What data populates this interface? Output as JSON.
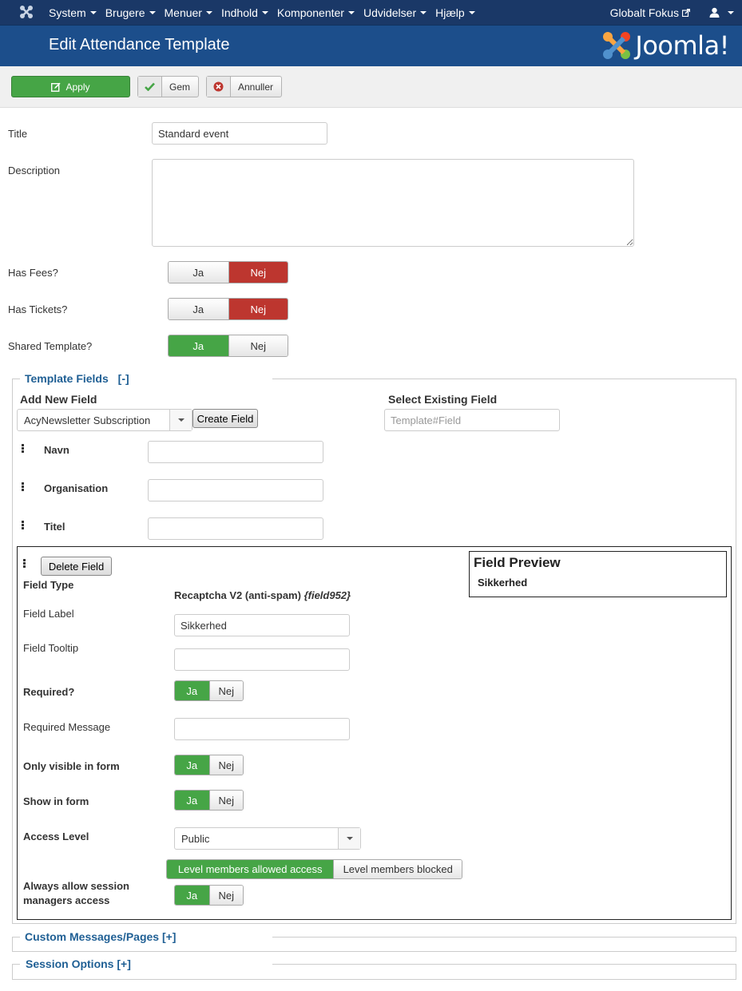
{
  "nav": {
    "items": [
      "System",
      "Brugere",
      "Menuer",
      "Indhold",
      "Komponenter",
      "Udvidelser",
      "Hjælp"
    ],
    "site_link": "Globalt Fokus"
  },
  "header": {
    "title": "Edit Attendance Template",
    "brand": "Joomla!"
  },
  "toolbar": {
    "apply": "Apply",
    "save": "Gem",
    "cancel": "Annuller"
  },
  "form": {
    "title_label": "Title",
    "title_value": "Standard event",
    "description_label": "Description",
    "description_value": "",
    "has_fees": {
      "label": "Has Fees?",
      "yes": "Ja",
      "no": "Nej",
      "selected": "Nej"
    },
    "has_tickets": {
      "label": "Has Tickets?",
      "yes": "Ja",
      "no": "Nej",
      "selected": "Nej"
    },
    "shared_template": {
      "label": "Shared Template?",
      "yes": "Ja",
      "no": "Nej",
      "selected": "Ja"
    }
  },
  "template_fields": {
    "legend": "Template Fields",
    "toggle": "[-]",
    "add_new_label": "Add New Field",
    "add_new_select": "AcyNewsletter Subscription",
    "create_button": "Create Field",
    "select_existing_label": "Select Existing Field",
    "select_existing_placeholder": "Template#Field",
    "fields": [
      {
        "label": "Navn",
        "value": ""
      },
      {
        "label": "Organisation",
        "value": ""
      },
      {
        "label": "Titel",
        "value": ""
      }
    ],
    "editor": {
      "delete_button": "Delete Field",
      "field_type_label": "Field Type",
      "field_type_value": "Recaptcha V2 (anti-spam)",
      "field_type_id": "{field952}",
      "field_label_label": "Field Label",
      "field_label_value": "Sikkerhed",
      "field_tooltip_label": "Field Tooltip",
      "field_tooltip_value": "",
      "required_label": "Required?",
      "required_message_label": "Required Message",
      "required_message_value": "",
      "only_visible_label": "Only visible in form",
      "show_in_form_label": "Show in form",
      "access_level_label": "Access Level",
      "access_level_value": "Public",
      "access_allowed": "Level members allowed access",
      "access_blocked": "Level members blocked",
      "always_allow_label_1": "Always allow session",
      "always_allow_label_2": "managers access",
      "yes": "Ja",
      "no": "Nej",
      "preview_title": "Field Preview",
      "preview_value": "Sikkerhed"
    }
  },
  "custom_messages": {
    "legend": "Custom Messages/Pages [+]"
  },
  "session_options": {
    "legend": "Session Options [+]"
  }
}
